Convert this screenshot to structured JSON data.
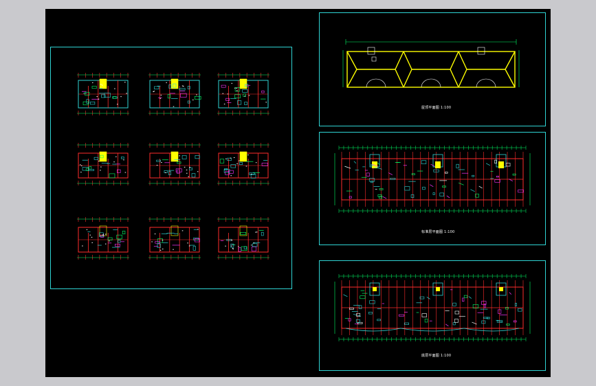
{
  "app": {
    "canvas_background": "#000000",
    "chrome_background": "#c9c9cd",
    "sheet_border_color": "#2fd5d5"
  },
  "colors": {
    "wall": "#ff2d2d",
    "dimension": "#00ff66",
    "accent_cyan": "#2fd5d5",
    "accent_magenta": "#ff33ff",
    "accent_yellow": "#ffff00",
    "text": "#ffffff"
  },
  "left_sheet": {
    "grid_rows": 3,
    "grid_cols": 3,
    "floor_plans": [
      {
        "row": 1,
        "col": 1
      },
      {
        "row": 1,
        "col": 2
      },
      {
        "row": 1,
        "col": 3
      },
      {
        "row": 2,
        "col": 1
      },
      {
        "row": 2,
        "col": 2
      },
      {
        "row": 2,
        "col": 3
      },
      {
        "row": 3,
        "col": 1
      },
      {
        "row": 3,
        "col": 2
      },
      {
        "row": 3,
        "col": 3
      }
    ]
  },
  "right_sheets": {
    "roof_plan": {
      "caption": "屋顶平面图",
      "scale": "1:100"
    },
    "standard_floor": {
      "caption": "标准层平面图",
      "scale": "1:100"
    },
    "ground_floor": {
      "caption": "底层平面图",
      "scale": "1:100"
    }
  }
}
